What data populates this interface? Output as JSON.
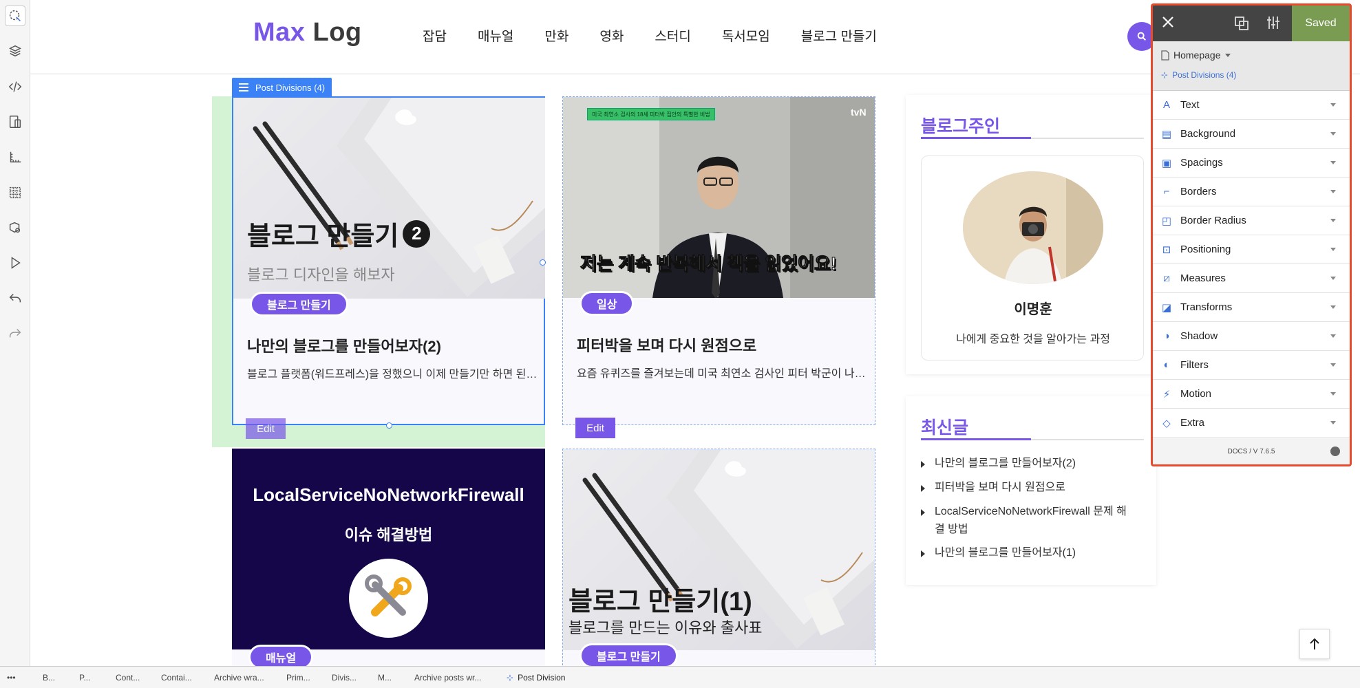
{
  "site": {
    "logo_max": "Max",
    "logo_log": "Log",
    "nav": [
      "잡담",
      "매뉴얼",
      "만화",
      "영화",
      "스터디",
      "독서모임",
      "블로그 만들기"
    ]
  },
  "selection_label": "Post Divisions (4)",
  "posts": [
    {
      "thumb_title": "블로그 만들기",
      "thumb_num": "2",
      "thumb_sub": "블로그 디자인을 해보자",
      "category": "블로그 만들기",
      "title": "나만의 블로그를 만들어보자(2)",
      "excerpt": "블로그 플랫폼(워드프레스)을 정했으니 이제 만들기만 하면 된…",
      "edit": "Edit"
    },
    {
      "thumb_caption": "저는 계속 반복해서 책을 읽었어요!",
      "thumb_badge": "미국 최연소 검사의 18세 피터박 집안의 특별한 비법",
      "thumb_channel": "tvN",
      "category": "일상",
      "title": "피터박을 보며 다시 원점으로",
      "excerpt": "요즘 유퀴즈를 즐겨보는데 미국 최연소 검사인 피터 박군이 나…",
      "edit": "Edit"
    },
    {
      "thumb_title": "LocalServiceNoNetworkFirewall",
      "thumb_sub": "이슈 해결방법",
      "category": "매뉴얼"
    },
    {
      "thumb_title": "블로그 만들기(1)",
      "thumb_sub": "블로그를 만드는 이유와 출사표",
      "category": "블로그 만들기"
    }
  ],
  "sidebar": {
    "owner_title": "블로그주인",
    "owner_name": "이명훈",
    "owner_desc": "나에게 중요한 것을 알아가는 과정",
    "recent_title": "최신글",
    "recent": [
      "나만의 블로그를 만들어보자(2)",
      "피터박을 보며 다시 원점으로",
      "LocalServiceNoNetworkFirewall 문제 해",
      "결 방법",
      "나만의 블로그를 만들어보자(1)"
    ]
  },
  "panel": {
    "saved": "Saved",
    "page": "Homepage",
    "element": "Post Divisions (4)",
    "sections": [
      "Text",
      "Background",
      "Spacings",
      "Borders",
      "Border Radius",
      "Positioning",
      "Measures",
      "Transforms",
      "Shadow",
      "Filters",
      "Motion",
      "Extra"
    ],
    "footer": "DOCS / V 7.6.5"
  },
  "breadcrumbs": [
    "B...",
    "P...",
    "Cont...",
    "Contai...",
    "Archive wra...",
    "Prim...",
    "Divis...",
    "M...",
    "Archive posts wr...",
    "Post Division"
  ],
  "colors": {
    "accent": "#7856e8",
    "selection": "#3b82f6",
    "panel_border": "#e84a2e",
    "saved": "#7a9b52"
  }
}
